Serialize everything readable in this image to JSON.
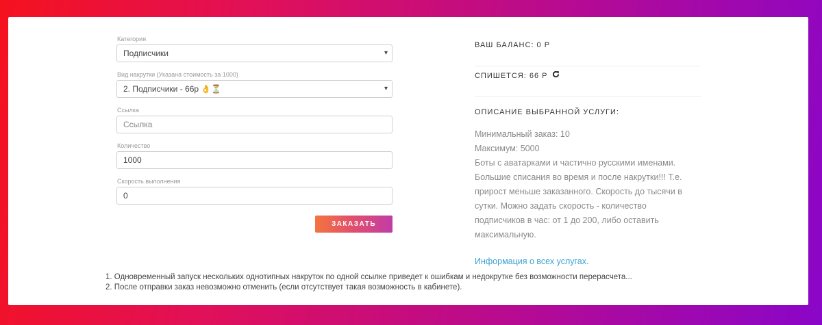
{
  "form": {
    "category": {
      "label": "Категория",
      "value": "Подписчики"
    },
    "service": {
      "label": "Вид накрутки (Указана стоимость за 1000)",
      "value": "2. Подписчики - 66р 👌⏳"
    },
    "link": {
      "label": "Ссылка",
      "placeholder": "Ссылка"
    },
    "quantity": {
      "label": "Количество",
      "value": "1000"
    },
    "speed": {
      "label": "Скорость выполнения",
      "value": "0"
    },
    "submit_label": "ЗАКАЗАТЬ"
  },
  "info": {
    "balance": "ВАШ БАЛАНС: 0 Р",
    "charge": "СПИШЕТСЯ: 66 Р",
    "desc_title": "ОПИСАНИЕ ВЫБРАННОЙ УСЛУГИ:",
    "min_order": "Минимальный заказ: 10",
    "max_order": "Максимум: 5000",
    "description": "Боты с аватарками и частично русскими именами. Большие списания во время и после накрутки!!! Т.е. прирост меньше заказанного. Скорость до тысячи в сутки. Можно задать скорость - количество подписчиков в час: от 1 до 200, либо оставить максимальную.",
    "all_services_link": "Информация о всех услугах."
  },
  "notes": [
    "1. Одновременный запуск нескольких однотипных накруток по одной ссылке приведет к ошибкам и недокрутке без возможности перерасчета...",
    "2. После отправки заказ невозможно отменить (если отсутствует такая возможность в кабинете)."
  ],
  "colors": {
    "accent_link": "#3aa3d2",
    "button_start": "#f4743f",
    "button_end": "#c13ca7"
  }
}
